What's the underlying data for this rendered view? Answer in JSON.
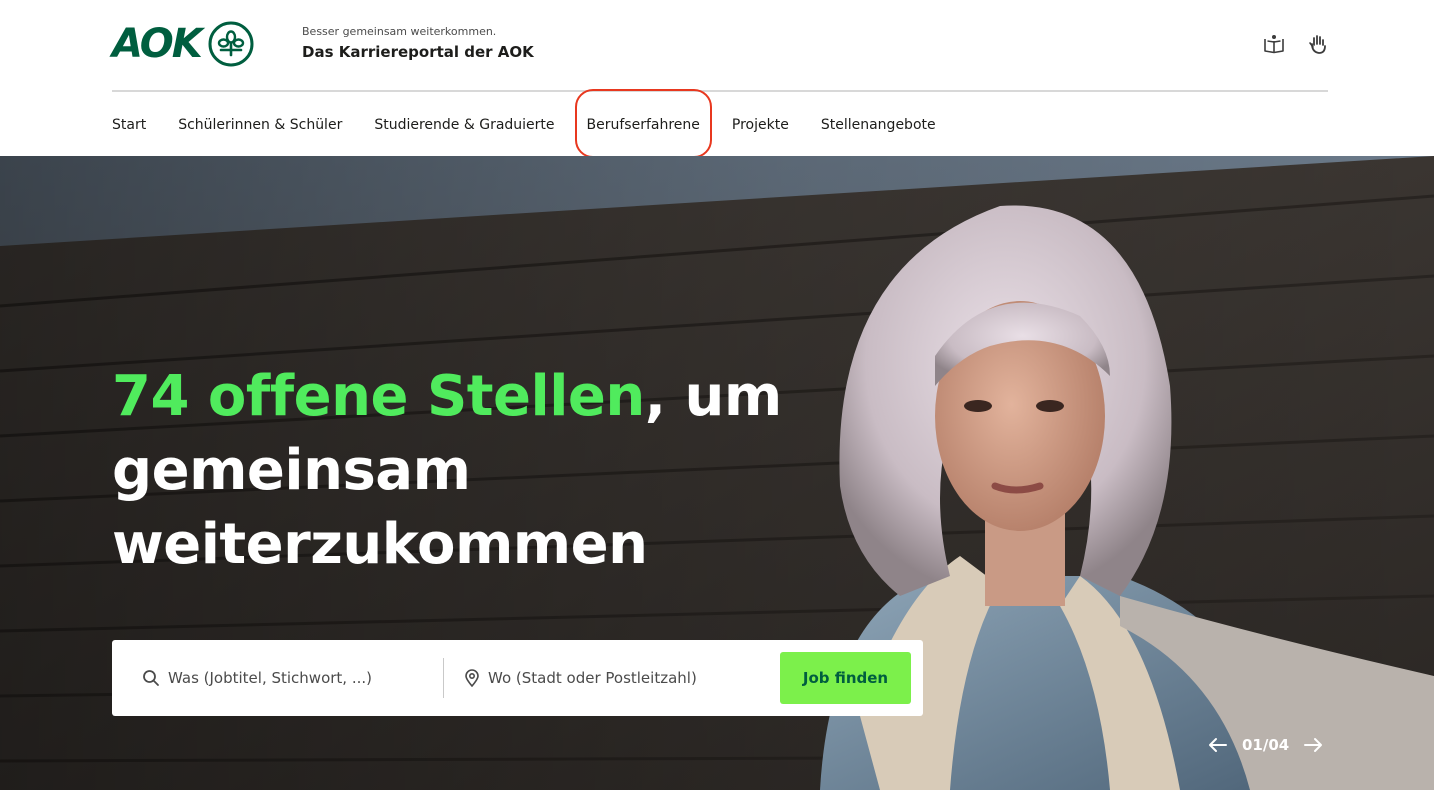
{
  "brand": {
    "logo_text": "AOK",
    "logo_icon": "aok-tree-emblem",
    "tagline_small": "Besser gemeinsam weiterkommen.",
    "tagline_main": "Das Karriereportal der AOK",
    "primary_color": "#005e3f",
    "accent_color": "#50eb5d"
  },
  "utility_icons": [
    {
      "icon": "easy-language-book-icon"
    },
    {
      "icon": "sign-language-hand-icon"
    }
  ],
  "nav": {
    "items": [
      {
        "label": "Start"
      },
      {
        "label": "Schülerinnen & Schüler"
      },
      {
        "label": "Studierende & Graduierte"
      },
      {
        "label": "Berufserfahrene",
        "highlighted": true
      },
      {
        "label": "Projekte"
      },
      {
        "label": "Stellenangebote"
      }
    ],
    "highlight_color": "#e8381f"
  },
  "hero": {
    "heading_accent": "74 offene Stellen",
    "heading_rest": ", um gemeinsam weiterzukommen",
    "search": {
      "what_placeholder": "Was (Jobtitel, Stichwort, ...)",
      "where_placeholder": "Wo (Stadt oder Postleitzahl)",
      "button_label": "Job finden",
      "button_color": "#7cf04b"
    },
    "slider": {
      "counter": "01/04"
    }
  }
}
